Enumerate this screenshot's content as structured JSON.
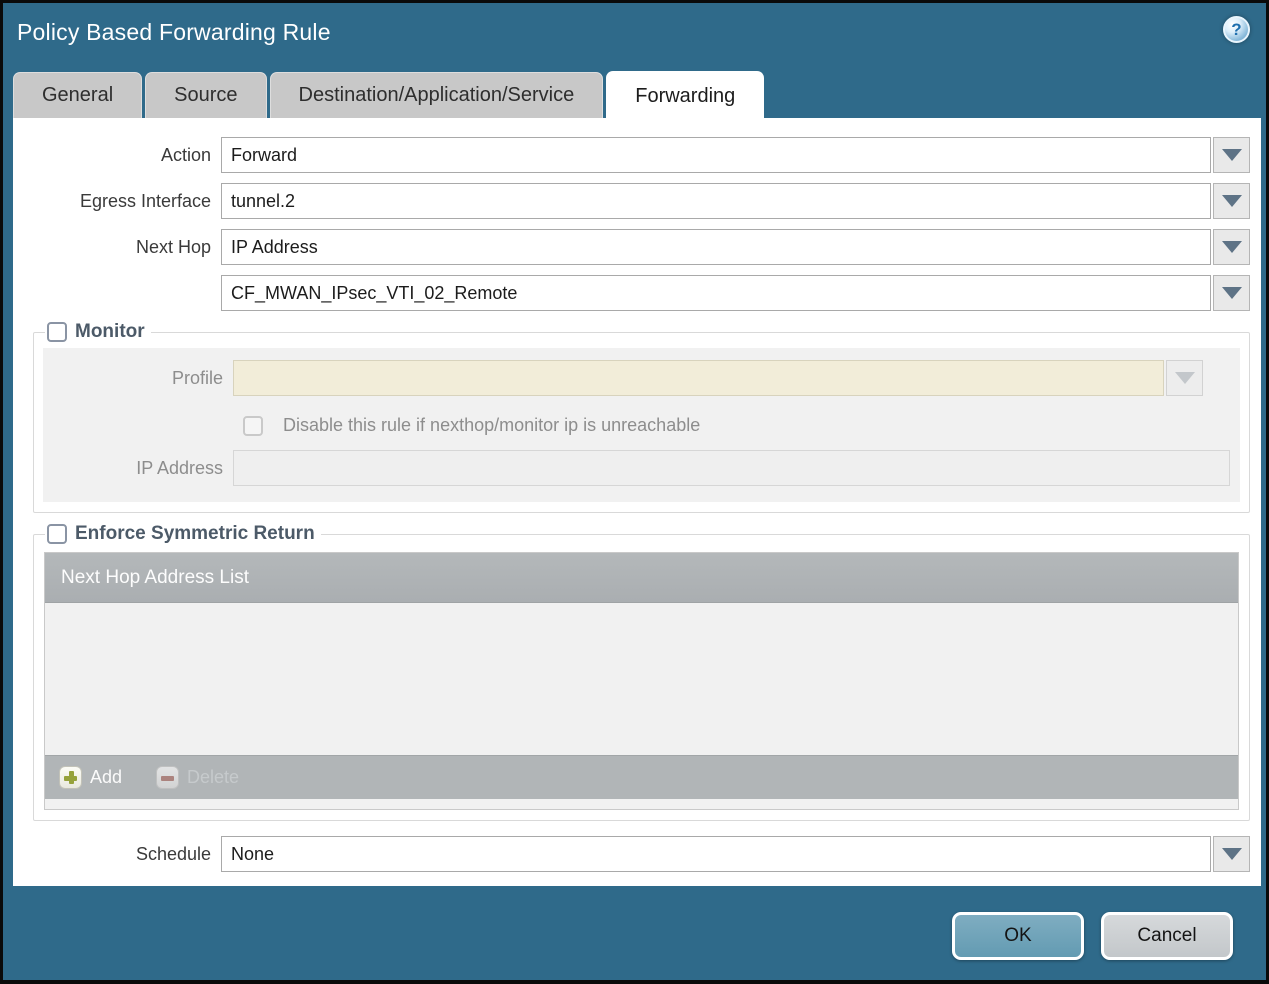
{
  "dialog": {
    "title": "Policy Based Forwarding Rule",
    "help_glyph": "?"
  },
  "tabs": [
    {
      "label": "General",
      "active": false
    },
    {
      "label": "Source",
      "active": false
    },
    {
      "label": "Destination/Application/Service",
      "active": false
    },
    {
      "label": "Forwarding",
      "active": true
    }
  ],
  "form": {
    "action": {
      "label": "Action",
      "value": "Forward"
    },
    "egress_interface": {
      "label": "Egress Interface",
      "value": "tunnel.2"
    },
    "next_hop": {
      "label": "Next Hop",
      "value": "IP Address"
    },
    "next_hop_address": {
      "value": "CF_MWAN_IPsec_VTI_02_Remote"
    },
    "schedule": {
      "label": "Schedule",
      "value": "None"
    }
  },
  "monitor": {
    "title": "Monitor",
    "checked": false,
    "profile": {
      "label": "Profile",
      "value": ""
    },
    "disable_rule_label": "Disable this rule if nexthop/monitor ip is unreachable",
    "disable_rule_checked": false,
    "ip_address": {
      "label": "IP Address",
      "value": ""
    }
  },
  "symmetric_return": {
    "title": "Enforce Symmetric Return",
    "checked": false,
    "table_header": "Next Hop Address List",
    "rows": [],
    "add_label": "Add",
    "delete_label": "Delete"
  },
  "footer": {
    "ok_label": "OK",
    "cancel_label": "Cancel"
  },
  "colors": {
    "dialog_teal": "#2F6A8A",
    "tab_inactive": "#C8C8C8",
    "table_header_grey": "#B1B5B7",
    "disabled_beige": "#F2EDD9",
    "ok_button": "#71A4BA",
    "cancel_button": "#CDD0D3",
    "section_title": "#4C5A68",
    "add_plus_green": "#96A23B",
    "delete_minus_red": "#A9736C"
  }
}
